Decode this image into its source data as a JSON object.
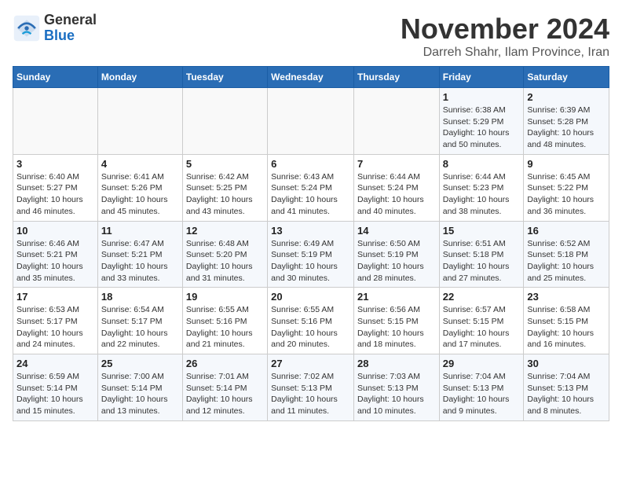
{
  "header": {
    "logo_general": "General",
    "logo_blue": "Blue",
    "month_title": "November 2024",
    "location": "Darreh Shahr, Ilam Province, Iran"
  },
  "weekdays": [
    "Sunday",
    "Monday",
    "Tuesday",
    "Wednesday",
    "Thursday",
    "Friday",
    "Saturday"
  ],
  "weeks": [
    [
      {
        "day": "",
        "info": ""
      },
      {
        "day": "",
        "info": ""
      },
      {
        "day": "",
        "info": ""
      },
      {
        "day": "",
        "info": ""
      },
      {
        "day": "",
        "info": ""
      },
      {
        "day": "1",
        "info": "Sunrise: 6:38 AM\nSunset: 5:29 PM\nDaylight: 10 hours\nand 50 minutes."
      },
      {
        "day": "2",
        "info": "Sunrise: 6:39 AM\nSunset: 5:28 PM\nDaylight: 10 hours\nand 48 minutes."
      }
    ],
    [
      {
        "day": "3",
        "info": "Sunrise: 6:40 AM\nSunset: 5:27 PM\nDaylight: 10 hours\nand 46 minutes."
      },
      {
        "day": "4",
        "info": "Sunrise: 6:41 AM\nSunset: 5:26 PM\nDaylight: 10 hours\nand 45 minutes."
      },
      {
        "day": "5",
        "info": "Sunrise: 6:42 AM\nSunset: 5:25 PM\nDaylight: 10 hours\nand 43 minutes."
      },
      {
        "day": "6",
        "info": "Sunrise: 6:43 AM\nSunset: 5:24 PM\nDaylight: 10 hours\nand 41 minutes."
      },
      {
        "day": "7",
        "info": "Sunrise: 6:44 AM\nSunset: 5:24 PM\nDaylight: 10 hours\nand 40 minutes."
      },
      {
        "day": "8",
        "info": "Sunrise: 6:44 AM\nSunset: 5:23 PM\nDaylight: 10 hours\nand 38 minutes."
      },
      {
        "day": "9",
        "info": "Sunrise: 6:45 AM\nSunset: 5:22 PM\nDaylight: 10 hours\nand 36 minutes."
      }
    ],
    [
      {
        "day": "10",
        "info": "Sunrise: 6:46 AM\nSunset: 5:21 PM\nDaylight: 10 hours\nand 35 minutes."
      },
      {
        "day": "11",
        "info": "Sunrise: 6:47 AM\nSunset: 5:21 PM\nDaylight: 10 hours\nand 33 minutes."
      },
      {
        "day": "12",
        "info": "Sunrise: 6:48 AM\nSunset: 5:20 PM\nDaylight: 10 hours\nand 31 minutes."
      },
      {
        "day": "13",
        "info": "Sunrise: 6:49 AM\nSunset: 5:19 PM\nDaylight: 10 hours\nand 30 minutes."
      },
      {
        "day": "14",
        "info": "Sunrise: 6:50 AM\nSunset: 5:19 PM\nDaylight: 10 hours\nand 28 minutes."
      },
      {
        "day": "15",
        "info": "Sunrise: 6:51 AM\nSunset: 5:18 PM\nDaylight: 10 hours\nand 27 minutes."
      },
      {
        "day": "16",
        "info": "Sunrise: 6:52 AM\nSunset: 5:18 PM\nDaylight: 10 hours\nand 25 minutes."
      }
    ],
    [
      {
        "day": "17",
        "info": "Sunrise: 6:53 AM\nSunset: 5:17 PM\nDaylight: 10 hours\nand 24 minutes."
      },
      {
        "day": "18",
        "info": "Sunrise: 6:54 AM\nSunset: 5:17 PM\nDaylight: 10 hours\nand 22 minutes."
      },
      {
        "day": "19",
        "info": "Sunrise: 6:55 AM\nSunset: 5:16 PM\nDaylight: 10 hours\nand 21 minutes."
      },
      {
        "day": "20",
        "info": "Sunrise: 6:55 AM\nSunset: 5:16 PM\nDaylight: 10 hours\nand 20 minutes."
      },
      {
        "day": "21",
        "info": "Sunrise: 6:56 AM\nSunset: 5:15 PM\nDaylight: 10 hours\nand 18 minutes."
      },
      {
        "day": "22",
        "info": "Sunrise: 6:57 AM\nSunset: 5:15 PM\nDaylight: 10 hours\nand 17 minutes."
      },
      {
        "day": "23",
        "info": "Sunrise: 6:58 AM\nSunset: 5:15 PM\nDaylight: 10 hours\nand 16 minutes."
      }
    ],
    [
      {
        "day": "24",
        "info": "Sunrise: 6:59 AM\nSunset: 5:14 PM\nDaylight: 10 hours\nand 15 minutes."
      },
      {
        "day": "25",
        "info": "Sunrise: 7:00 AM\nSunset: 5:14 PM\nDaylight: 10 hours\nand 13 minutes."
      },
      {
        "day": "26",
        "info": "Sunrise: 7:01 AM\nSunset: 5:14 PM\nDaylight: 10 hours\nand 12 minutes."
      },
      {
        "day": "27",
        "info": "Sunrise: 7:02 AM\nSunset: 5:13 PM\nDaylight: 10 hours\nand 11 minutes."
      },
      {
        "day": "28",
        "info": "Sunrise: 7:03 AM\nSunset: 5:13 PM\nDaylight: 10 hours\nand 10 minutes."
      },
      {
        "day": "29",
        "info": "Sunrise: 7:04 AM\nSunset: 5:13 PM\nDaylight: 10 hours\nand 9 minutes."
      },
      {
        "day": "30",
        "info": "Sunrise: 7:04 AM\nSunset: 5:13 PM\nDaylight: 10 hours\nand 8 minutes."
      }
    ]
  ]
}
